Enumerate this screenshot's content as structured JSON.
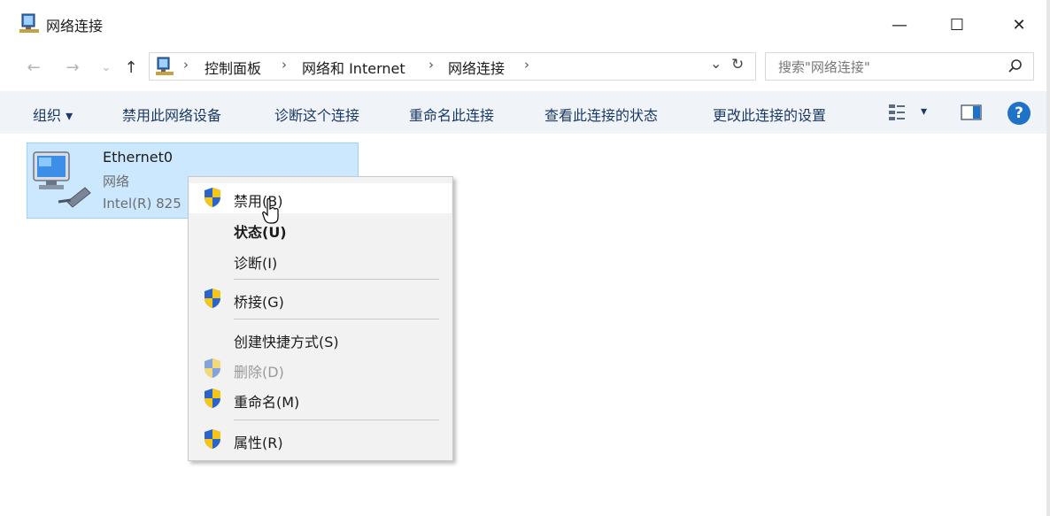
{
  "window": {
    "title": "网络连接",
    "minimize": "—",
    "maximize": "☐",
    "close": "✕"
  },
  "nav": {
    "back": "←",
    "forward": "→",
    "recent": "⌄",
    "up": "↑",
    "breadcrumb": [
      "控制面板",
      "网络和 Internet",
      "网络连接"
    ],
    "sep": "›",
    "dropdown": "⌄",
    "refresh": "↻"
  },
  "search": {
    "placeholder": "搜索\"网络连接\"",
    "icon": "⌕"
  },
  "toolbar": {
    "organize": "组织 ▾",
    "items": [
      "禁用此网络设备",
      "诊断这个连接",
      "重命名此连接",
      "查看此连接的状态",
      "更改此连接的设置"
    ],
    "view_arrow": "▾",
    "help": "?"
  },
  "connection": {
    "name": "Ethernet0",
    "type": "网络",
    "device": "Intel(R) 825"
  },
  "context_menu": {
    "disable": "禁用(B)",
    "status": "状态(U)",
    "diagnose": "诊断(I)",
    "bridge": "桥接(G)",
    "shortcut": "创建快捷方式(S)",
    "delete": "删除(D)",
    "rename": "重命名(M)",
    "properties": "属性(R)"
  },
  "colors": {
    "toolbar_bg": "#f0f4f9",
    "selection": "#cce8ff",
    "shield_blue": "#2b63c8",
    "shield_yellow": "#f5c518"
  }
}
